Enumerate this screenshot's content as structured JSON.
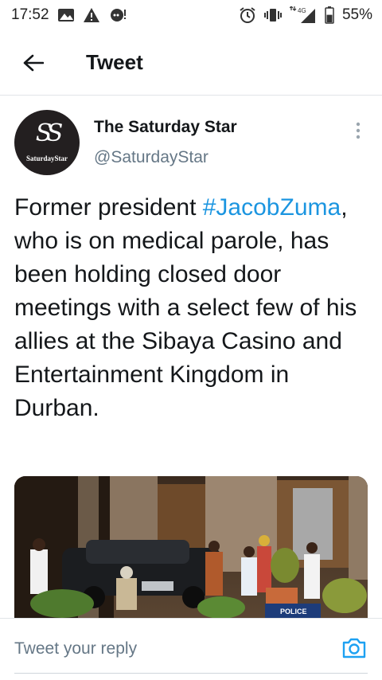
{
  "status_bar": {
    "time": "17:52",
    "network_label": "4G",
    "battery": "55%",
    "battery_level": 0.55
  },
  "header": {
    "title": "Tweet",
    "back_icon": "arrow-left-icon"
  },
  "tweet": {
    "avatar": {
      "monogram": "SS",
      "wordmark": "SaturdayStar"
    },
    "display_name": "The Saturday Star",
    "handle": "@SaturdayStar",
    "text_before": "Former president ",
    "hashtag": "#JacobZuma",
    "text_after": ", who is on medical parole, has been holding closed door meetings with a select few of his allies at the Sibaya Casino and Entertainment Kingdom in Durban.",
    "media_sign": "POLICE"
  },
  "reply": {
    "placeholder": "Tweet your reply",
    "value": ""
  },
  "colors": {
    "hashtag": "#1b95e0",
    "handle": "#657786",
    "accent": "#1da1f2"
  }
}
